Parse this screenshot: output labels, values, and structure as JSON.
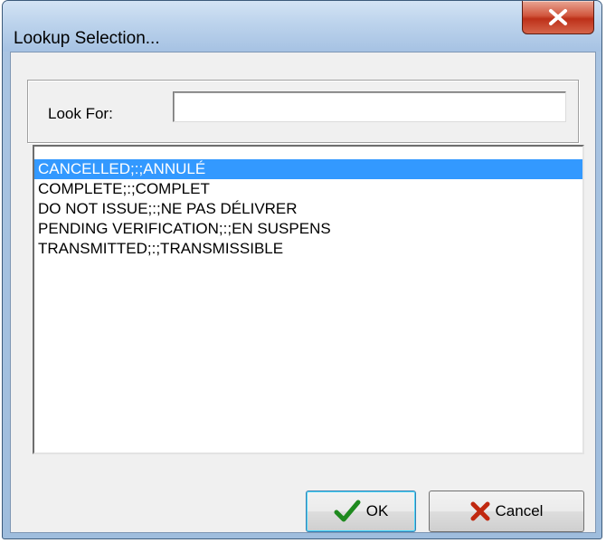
{
  "window": {
    "title": "Lookup Selection..."
  },
  "search": {
    "label": "Look For:",
    "value": ""
  },
  "list": {
    "items": [
      "CANCELLED;:;ANNULÉ",
      "COMPLETE;:;COMPLET",
      "DO NOT ISSUE;:;NE PAS DÉLIVRER",
      "PENDING VERIFICATION;:;EN SUSPENS",
      "TRANSMITTED;:;TRANSMISSIBLE"
    ],
    "selected_index": 0
  },
  "buttons": {
    "ok": "OK",
    "cancel": "Cancel"
  },
  "icons": {
    "close": "close-icon",
    "ok": "checkmark-icon",
    "cancel": "x-mark-icon"
  },
  "colors": {
    "selection": "#3399ff",
    "ok_check": "#1f8a1f",
    "cancel_x": "#c0280f",
    "close_button": "#c84a31"
  }
}
